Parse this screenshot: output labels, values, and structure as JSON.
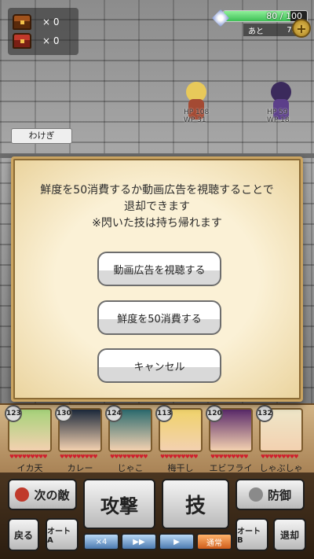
{
  "hud": {
    "chest_gold_count": "× 0",
    "chest_red_count": "× 0",
    "vitality_text": "80 / 100",
    "vitality_fraction": 0.8,
    "remain_label": "あと",
    "remain_value": "79",
    "plus_label": "+"
  },
  "enemies": [
    {
      "hp": "HP 108",
      "wp": "WP 31"
    },
    {
      "hp": "HP 59",
      "wp": "WP 18"
    }
  ],
  "skill_tag": "わけぎ",
  "dialog": {
    "message_line1": "鮮度を50消費するか動画広告を視聴することで",
    "message_line2": "退却できます",
    "message_line3": "※閃いた技は持ち帰れます",
    "btn_watch_ad": "動画広告を視聴する",
    "btn_consume": "鮮度を50消費する",
    "btn_cancel": "キャンセル"
  },
  "party": [
    {
      "level": "123",
      "name": "イカ天"
    },
    {
      "level": "130",
      "name": "カレー"
    },
    {
      "level": "124",
      "name": "じゃこ"
    },
    {
      "level": "113",
      "name": "梅干し"
    },
    {
      "level": "120",
      "name": "エビフライ"
    },
    {
      "level": "132",
      "name": "しゃぶしゃぶ"
    }
  ],
  "commands": {
    "next_enemy": "次の敵",
    "attack": "攻撃",
    "skill": "技",
    "defend": "防御",
    "back": "戻る",
    "auto_a": "オート A",
    "auto_b": "オート B",
    "retreat": "退却",
    "speed_x4": "×4",
    "speed_active": "通常"
  },
  "colors": {
    "dialog_bg": "#fbf1d6",
    "vitality_green": "#3dbf55",
    "heart_red": "#d01e2c"
  }
}
